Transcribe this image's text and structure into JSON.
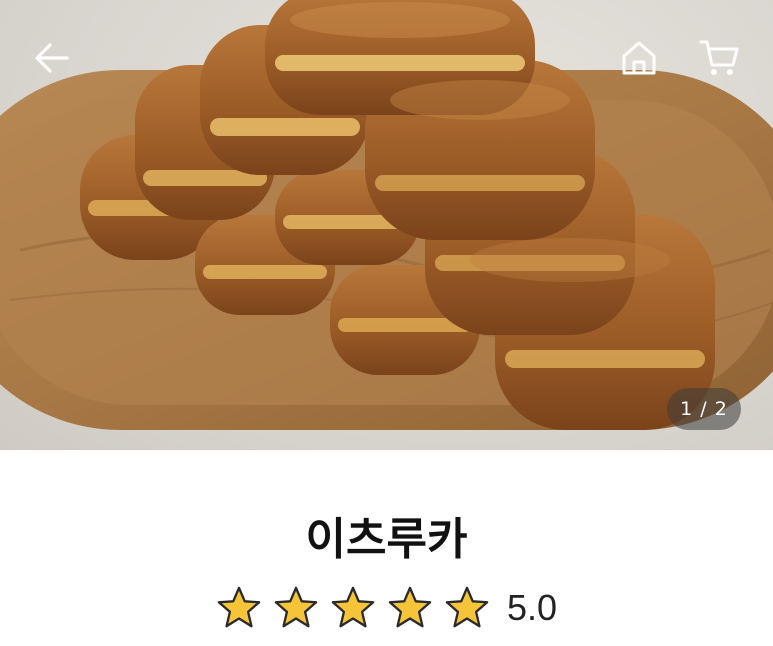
{
  "product": {
    "name": "이츠루카",
    "rating_value": 5,
    "rating_text": "5.0"
  },
  "gallery": {
    "current": 1,
    "total": 2,
    "counter_text": "1 / 2"
  },
  "icons": {
    "back": "arrow-left-icon",
    "home": "home-icon",
    "cart": "cart-icon",
    "star": "star-icon"
  },
  "colors": {
    "star_fill": "#F5C438",
    "star_stroke": "#2A2A2A",
    "title": "#111111"
  }
}
